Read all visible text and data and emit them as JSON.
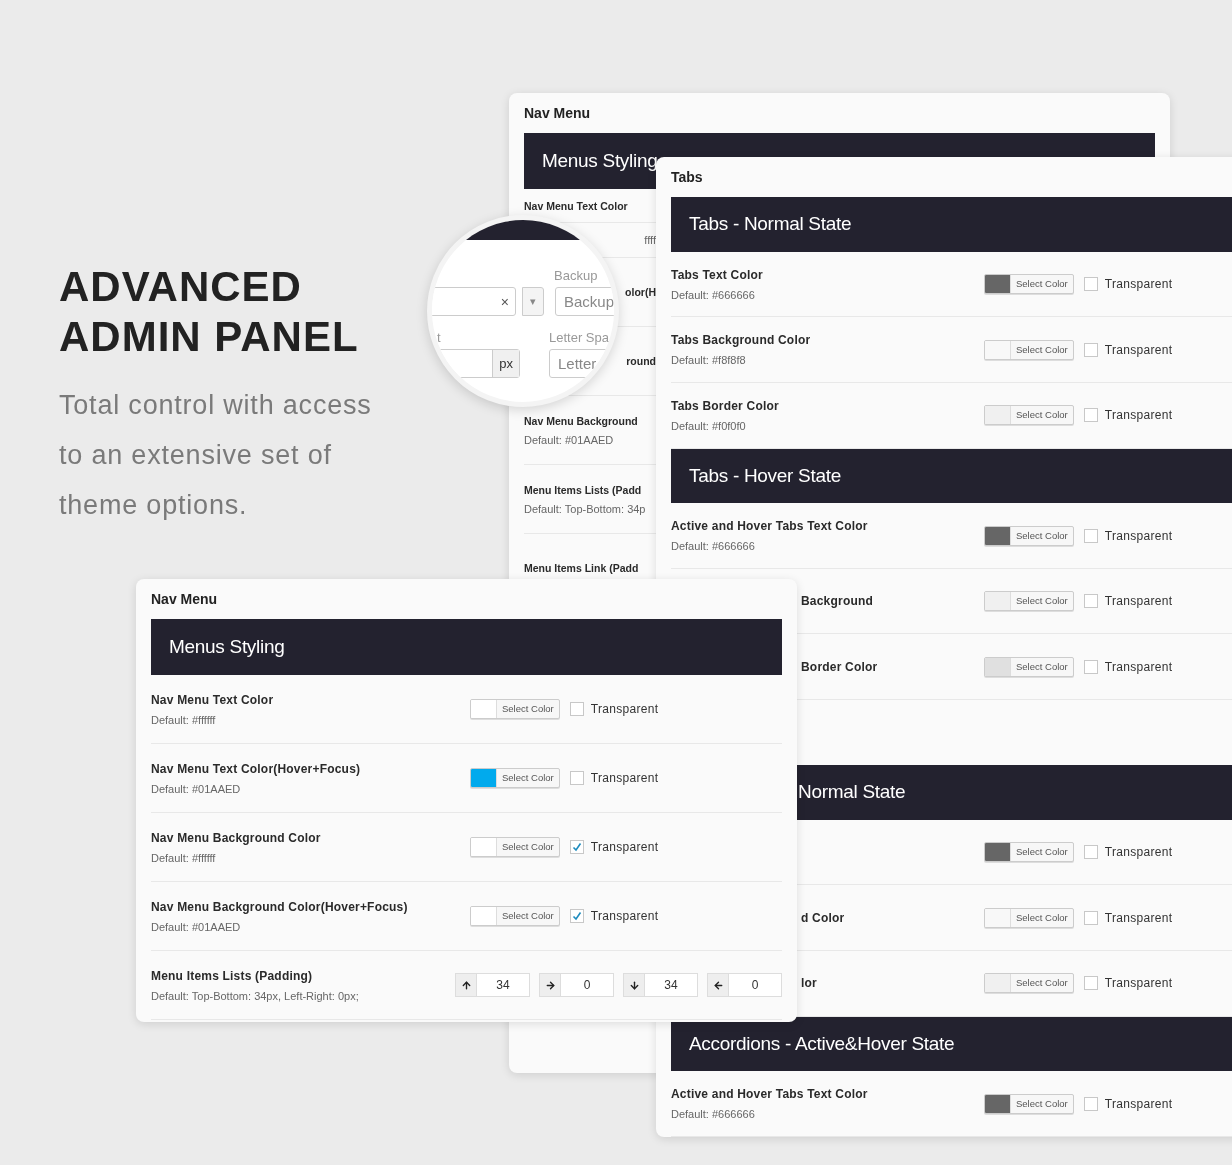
{
  "hero": {
    "title_lines": [
      "ADVANCED",
      "ADMIN PANEL"
    ],
    "subtitle": "Total control with access to an extensive set of theme options."
  },
  "back_panel": {
    "title": "Nav Menu",
    "header": "Menus Styling",
    "rows": [
      {
        "kind": "full",
        "label": "Nav Menu Text Color"
      },
      {
        "kind": "partial",
        "default": "ffff"
      },
      {
        "kind": "partial",
        "label": "olor(H"
      },
      {
        "kind": "partial",
        "label": "round"
      },
      {
        "kind": "full",
        "label": "Nav Menu Background",
        "default": "Default: #01AAED"
      },
      {
        "kind": "full",
        "label": "Menu Items Lists (Padd",
        "default": "Default: Top-Bottom: 34p"
      },
      {
        "kind": "full",
        "label": "Menu Items Link (Padd"
      }
    ]
  },
  "magnifier": {
    "select_label": "Backup",
    "select_clear": "×",
    "select_arrow": "▾",
    "backup_placeholder": "Backup",
    "px_label": "t",
    "px_addon": "px",
    "letter_label": "Letter Spa",
    "letter_placeholder": "Letter"
  },
  "tabs_panel": {
    "title": "Tabs",
    "sections": [
      {
        "kind": "full",
        "header": "Tabs - Normal State",
        "rows": [
          {
            "kind": "full",
            "label": "Tabs Text Color",
            "default": "Default: #666666",
            "color": "#666666",
            "button": "Select Color",
            "checkbox": "Transparent",
            "checked": false
          },
          {
            "kind": "full",
            "label": "Tabs Background Color",
            "default": "Default: #f8f8f8",
            "color": "#f8f8f8",
            "button": "Select Color",
            "checkbox": "Transparent",
            "checked": false
          },
          {
            "kind": "full",
            "label": "Tabs Border Color",
            "default": "Default: #f0f0f0",
            "color": "#f0f0f0",
            "button": "Select Color",
            "checkbox": "Transparent",
            "checked": false
          }
        ]
      },
      {
        "kind": "full",
        "header": "Tabs - Hover State",
        "rows": [
          {
            "kind": "full",
            "label": "Active and Hover Tabs Text Color",
            "default": "Default: #666666",
            "color": "#666666",
            "button": "Select Color",
            "checkbox": "Transparent",
            "checked": false
          },
          {
            "kind": "partial",
            "label": "Background",
            "color": "#f0f0f0",
            "button": "Select Color",
            "checkbox": "Transparent",
            "checked": false
          },
          {
            "kind": "partial",
            "label": "Border Color",
            "color": "#e0e0e0",
            "button": "Select Color",
            "checkbox": "Transparent",
            "checked": false
          }
        ]
      },
      {
        "kind": "partial",
        "header": "Normal State",
        "rows": [
          {
            "kind": "partial",
            "color": "#666666",
            "button": "Select Color",
            "checkbox": "Transparent",
            "checked": false
          },
          {
            "kind": "partial",
            "label": "d Color",
            "color": "#f8f8f8",
            "button": "Select Color",
            "checkbox": "Transparent",
            "checked": false
          },
          {
            "kind": "partial",
            "label": "lor",
            "color": "#f0f0f0",
            "button": "Select Color",
            "checkbox": "Transparent",
            "checked": false
          }
        ]
      },
      {
        "kind": "full",
        "header": "Accordions - Active&Hover State",
        "rows": [
          {
            "kind": "full",
            "label": "Active and Hover Tabs Text Color",
            "default": "Default: #666666",
            "color": "#666666",
            "button": "Select Color",
            "checkbox": "Transparent",
            "checked": false
          }
        ]
      }
    ]
  },
  "front_panel": {
    "title": "Nav Menu",
    "header": "Menus Styling",
    "rows": [
      {
        "kind": "color",
        "label": "Nav Menu Text Color",
        "default": "Default: #ffffff",
        "color": "#ffffff",
        "button": "Select Color",
        "checkbox": "Transparent",
        "checked": false
      },
      {
        "kind": "color",
        "label": "Nav Menu Text Color(Hover+Focus)",
        "default": "Default: #01AAED",
        "color": "#01aaed",
        "button": "Select Color",
        "checkbox": "Transparent",
        "checked": false
      },
      {
        "kind": "color",
        "label": "Nav Menu Background Color",
        "default": "Default: #ffffff",
        "color": "#ffffff",
        "button": "Select Color",
        "checkbox": "Transparent",
        "checked": true
      },
      {
        "kind": "color",
        "label": "Nav Menu Background Color(Hover+Focus)",
        "default": "Default: #01AAED",
        "color": "#ffffff",
        "button": "Select Color",
        "checkbox": "Transparent",
        "checked": true
      },
      {
        "kind": "padding",
        "label": "Menu Items Lists (Padding)",
        "default": "Default: Top-Bottom: 34px, Left-Right: 0px;",
        "inputs": [
          {
            "kind": "up",
            "value": "34"
          },
          {
            "kind": "right",
            "value": "0"
          },
          {
            "kind": "down",
            "value": "34"
          },
          {
            "kind": "left",
            "value": "0"
          }
        ]
      }
    ]
  }
}
